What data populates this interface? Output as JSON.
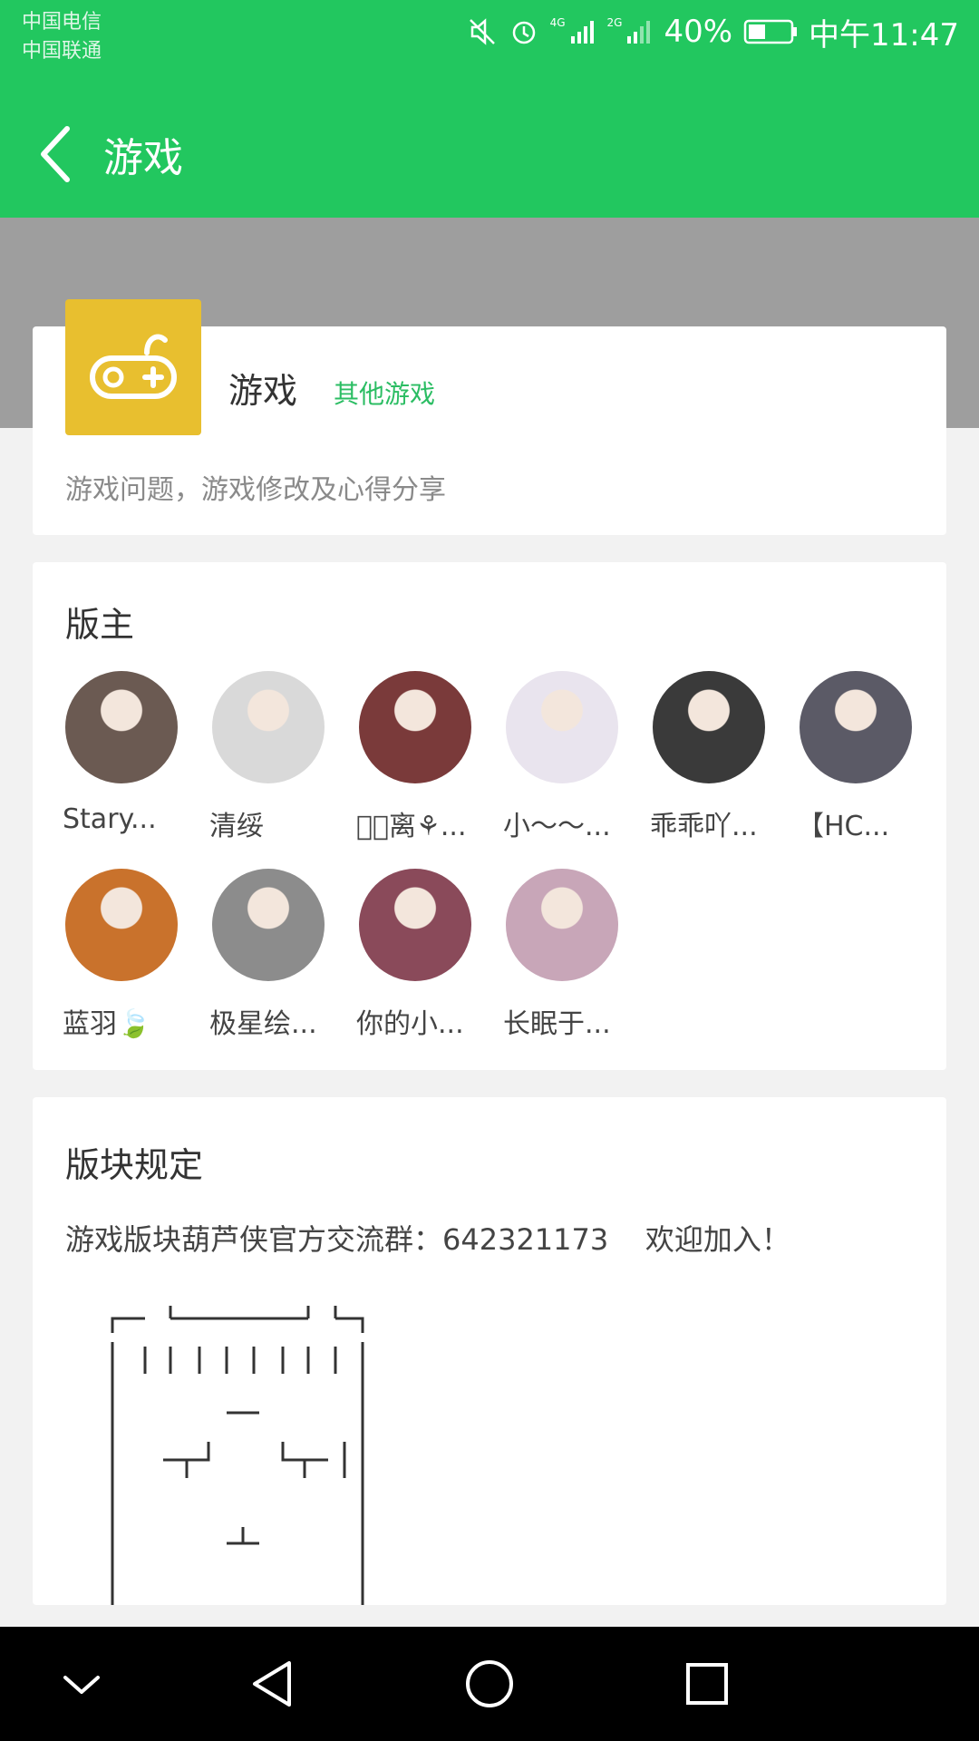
{
  "status_bar": {
    "carrier_1": "中国电信",
    "carrier_2": "中国联通",
    "signal_1": "4G",
    "signal_2": "2G",
    "battery": "40%",
    "time": "中午11:47"
  },
  "header": {
    "title": "游戏"
  },
  "forum": {
    "name": "游戏",
    "category": "其他游戏",
    "description": "游戏问题，游戏修改及心得分享"
  },
  "moderators": {
    "title": "版主",
    "list": [
      {
        "name": "Stary...",
        "color": "#6b5a52"
      },
      {
        "name": "清绥",
        "color": "#d9d9d9"
      },
      {
        "name": "亿⃰离⚘...",
        "color": "#7a3a3a"
      },
      {
        "name": "小～～...",
        "color": "#e9e4ee"
      },
      {
        "name": "乖乖吖...",
        "color": "#3a3a3a"
      },
      {
        "name": "【HC...",
        "color": "#5b5a66"
      },
      {
        "name": "蓝羽🍃",
        "color": "#c9722c"
      },
      {
        "name": "极星绘...",
        "color": "#8c8c8c"
      },
      {
        "name": "你的小...",
        "color": "#8a4a5a"
      },
      {
        "name": "长眠于...",
        "color": "#c8a6b8"
      }
    ]
  },
  "rules": {
    "title": "版块规定",
    "text": "游戏版块葫芦侠官方交流群：642321173    欢迎加入！"
  },
  "colors": {
    "accent": "#22c75f",
    "tag": "#2bbd63",
    "icon_bg": "#e8bf2f"
  }
}
